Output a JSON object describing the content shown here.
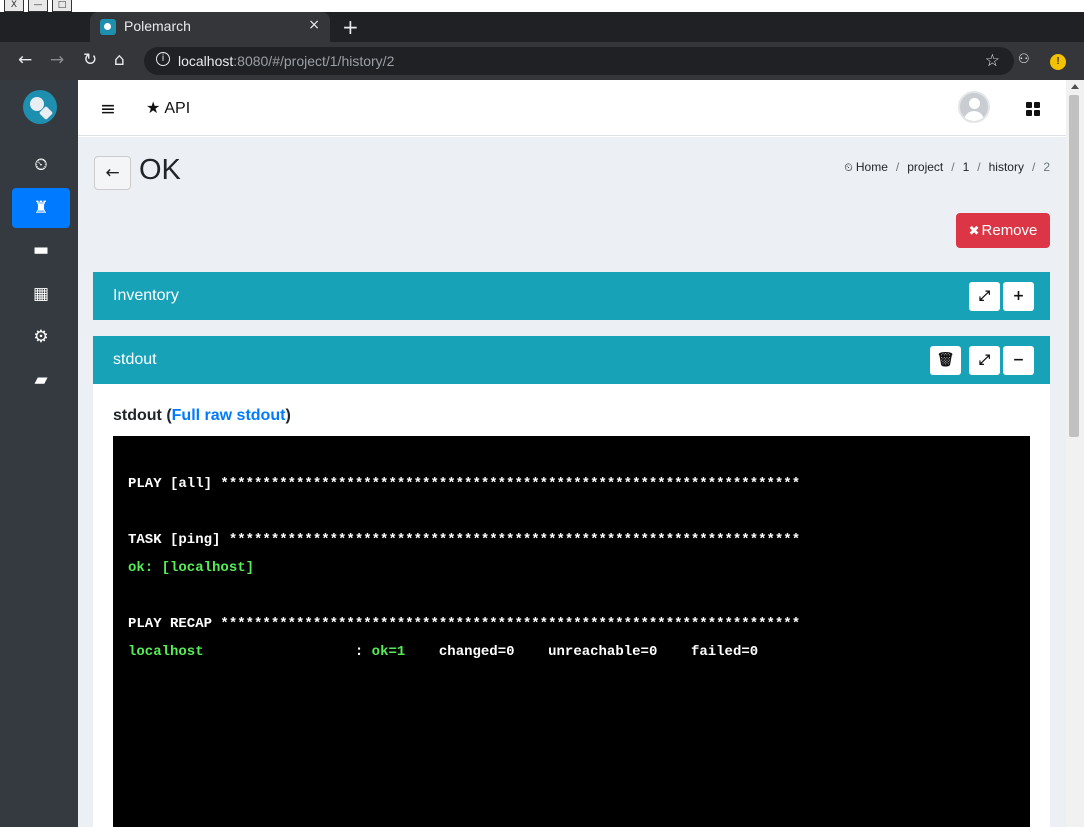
{
  "window": {
    "buttons": [
      "X",
      "—",
      "□"
    ]
  },
  "browser": {
    "tab_title": "Polemarch",
    "tab_close": "×",
    "new_tab": "+",
    "url_host": "localhost",
    "url_rest": ":8080/#/project/1/history/2"
  },
  "sidebar": {
    "items": [
      {
        "name": "dashboard",
        "icon": "tachometer-icon"
      },
      {
        "name": "projects",
        "icon": "castle-icon",
        "active": true
      },
      {
        "name": "folder",
        "icon": "folder-icon"
      },
      {
        "name": "calendar",
        "icon": "calendar-icon"
      },
      {
        "name": "settings",
        "icon": "gear-icon"
      },
      {
        "name": "docs",
        "icon": "book-icon"
      }
    ]
  },
  "topnav": {
    "api_label": "API"
  },
  "page": {
    "title": "OK",
    "breadcrumb": [
      "Home",
      "project",
      "1",
      "history",
      "2"
    ],
    "breadcrumb_sep": "/",
    "remove_label": "Remove"
  },
  "inventory": {
    "title": "Inventory"
  },
  "stdout_card": {
    "title": "stdout",
    "label": "stdout",
    "link": "Full raw stdout",
    "open_paren": " (",
    "close_paren": ")"
  },
  "terminal": {
    "lines": [
      "PLAY [all] *********************************************************************",
      "TASK [ping] ********************************************************************",
      "ok: [localhost]",
      "PLAY RECAP *********************************************************************"
    ],
    "recap": {
      "host": "localhost",
      "pad": "                  ",
      "colon": ": ",
      "ok": "ok=1",
      "changed": "changed=0",
      "unreachable": "unreachable=0",
      "failed": "failed=0"
    }
  },
  "colors": {
    "sidebar": "#343a40",
    "active": "#007bff",
    "card_header": "#17a2b8",
    "remove": "#dc3545",
    "ok_green": "#55ee55"
  }
}
